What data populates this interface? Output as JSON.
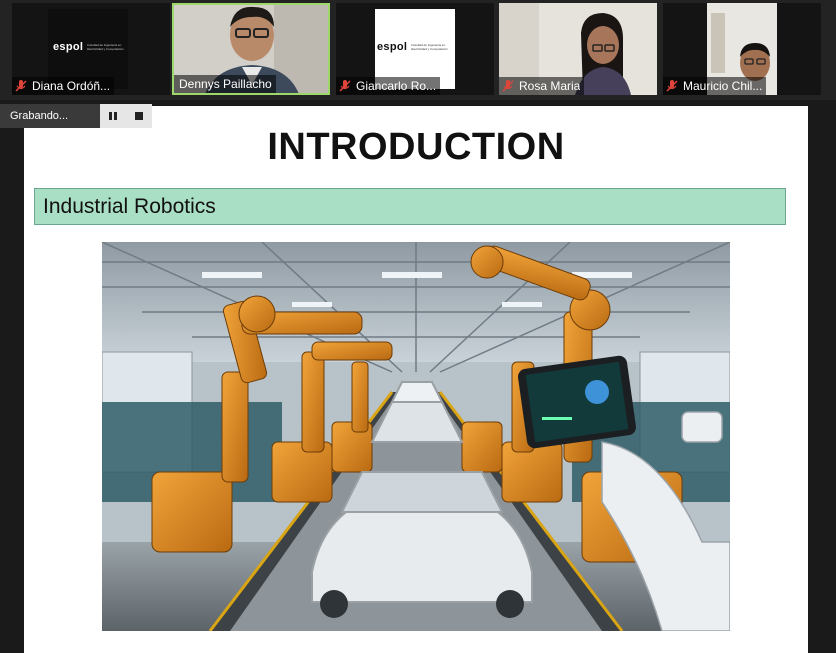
{
  "participants": [
    {
      "name": "Diana Ordóñ...",
      "muted": true,
      "video": "logo"
    },
    {
      "name": "Dennys Paillacho",
      "muted": false,
      "video": "camera",
      "active": true
    },
    {
      "name": "Giancarlo Ro...",
      "muted": true,
      "video": "logo"
    },
    {
      "name": "Rosa Maria",
      "muted": true,
      "video": "camera"
    },
    {
      "name": "Mauricio Chil...",
      "muted": true,
      "video": "camera"
    }
  ],
  "logo": {
    "word": "espol",
    "sub": "Facultad de Ingeniería en Electricidad y Computación"
  },
  "recording": {
    "label": "Grabando...",
    "pause_icon": "pause-icon",
    "stop_icon": "stop-icon"
  },
  "slide": {
    "title": "INTRODUCTION",
    "section_heading": "Industrial Robotics",
    "image": "factory-robot-arms-car-assembly-line"
  },
  "colors": {
    "accent_green": "#9ed86a",
    "section_bg": "#a9dfc5",
    "muted_mic": "#e0453a",
    "robot_orange": "#e08a1e"
  }
}
